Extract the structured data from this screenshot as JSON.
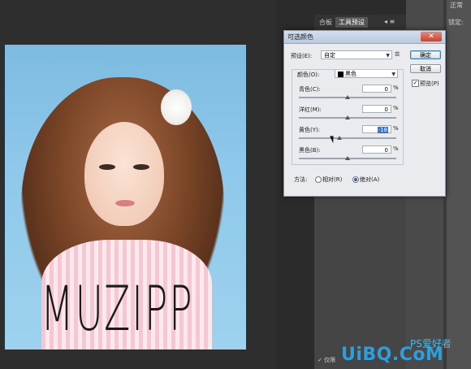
{
  "window": {
    "right_label_top": "正常",
    "right_label_lock": "锁定:"
  },
  "panel": {
    "tabs": [
      "合板",
      "工具预设"
    ]
  },
  "document": {
    "watermark": "MUZIPP"
  },
  "dialog": {
    "title": "可选颜色",
    "preset_label": "预设(E):",
    "preset_value": "自定",
    "colors_label": "颜色(O):",
    "colors_value": "黑色",
    "ok_label": "确定",
    "cancel_label": "取消",
    "preview_label": "预览(P)",
    "preview_checked": true,
    "method_label": "方法:",
    "method_relative": "相对(R)",
    "method_absolute": "绝对(A)",
    "method_selected": "absolute",
    "sliders": [
      {
        "label": "青色(C):",
        "value": "0",
        "pct": "%",
        "level": 0
      },
      {
        "label": "洋红(M):",
        "value": "0",
        "pct": "%",
        "level": 0
      },
      {
        "label": "黄色(Y):",
        "value": "-18",
        "pct": "%",
        "level": -18,
        "selected": true
      },
      {
        "label": "黑色(B):",
        "value": "0",
        "pct": "%",
        "level": 0
      }
    ]
  },
  "status": {
    "text": "✓ 仅限"
  },
  "branding": {
    "logo": "UiBQ.CoM",
    "logo_cn": "PS爱好者"
  },
  "colors": {
    "dialog_bg": "#e9ebee",
    "titlebar": "#c7d4e6",
    "close": "#c3442f",
    "logo": "#2e9edc"
  }
}
